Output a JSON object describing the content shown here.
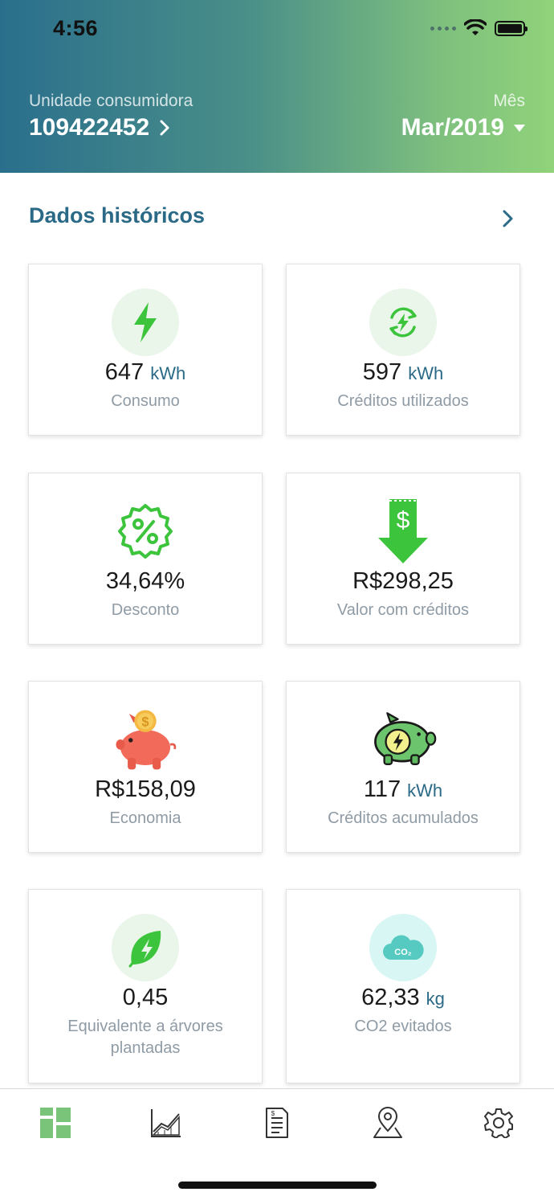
{
  "status_bar": {
    "time": "4:56"
  },
  "header": {
    "unit_label": "Unidade consumidora",
    "unit_value": "109422452",
    "month_label": "Mês",
    "month_value": "Mar/2019"
  },
  "section": {
    "title": "Dados históricos"
  },
  "cards": [
    {
      "value": "647",
      "unit": "kWh",
      "label": "Consumo",
      "icon": "lightning-icon"
    },
    {
      "value": "597",
      "unit": "kWh",
      "label": "Créditos utilizados",
      "icon": "recycle-energy-icon"
    },
    {
      "value": "34,64%",
      "unit": "",
      "label": "Desconto",
      "icon": "discount-badge-icon"
    },
    {
      "value": "R$298,25",
      "unit": "",
      "label": "Valor com créditos",
      "icon": "money-down-arrow-icon"
    },
    {
      "value": "R$158,09",
      "unit": "",
      "label": "Economia",
      "icon": "piggy-bank-coin-icon"
    },
    {
      "value": "117",
      "unit": "kWh",
      "label": "Créditos acumulados",
      "icon": "piggy-bank-energy-icon"
    },
    {
      "value": "0,45",
      "unit": "",
      "label": "Equivalente a árvores plantadas",
      "icon": "leaf-energy-icon"
    },
    {
      "value": "62,33",
      "unit": "kg",
      "label": "CO2 evitados",
      "icon": "co2-cloud-icon",
      "icon_text": "CO₂"
    }
  ],
  "tabs": [
    {
      "icon": "dashboard-icon",
      "active": true
    },
    {
      "icon": "chart-icon",
      "active": false
    },
    {
      "icon": "invoice-icon",
      "active": false
    },
    {
      "icon": "map-pin-icon",
      "active": false
    },
    {
      "icon": "settings-gear-icon",
      "active": false
    }
  ],
  "colors": {
    "primary": "#2b6a87",
    "green": "#3cc43c",
    "active_tab": "#7ac47a",
    "label_gray": "#8f9ba5"
  }
}
